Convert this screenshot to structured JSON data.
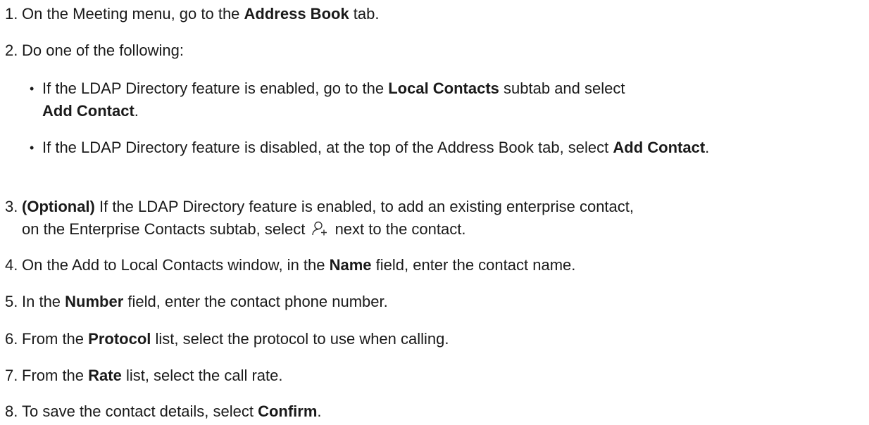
{
  "steps": [
    {
      "n": "1.",
      "a": "On the Meeting menu, go to the ",
      "b": "Address Book",
      "c": " tab."
    },
    {
      "n": "2.",
      "a": "Do one of the following:"
    },
    {
      "n": "3.",
      "b": "(Optional)",
      "c": " If the LDAP Directory feature is enabled, to add an existing enterprise contact,",
      "d": "on the Enterprise Contacts subtab, select ",
      "e": " next to the contact.",
      "icon": "add-contact-icon"
    },
    {
      "n": "4.",
      "a": "On the Add to Local Contacts window, in the ",
      "b": "Name",
      "c": " field, enter the contact name."
    },
    {
      "n": "5.",
      "a": "In the ",
      "b": "Number",
      "c": " field, enter the contact phone number."
    },
    {
      "n": "6.",
      "a": "From the ",
      "b": "Protocol",
      "c": " list, select the protocol to use when calling."
    },
    {
      "n": "7.",
      "a": "From the ",
      "b": "Rate",
      "c": " list, select the call rate."
    },
    {
      "n": "8.",
      "a": "To save the contact details, select ",
      "b": "Confirm",
      "c": "."
    }
  ],
  "bullets": [
    {
      "dot": "•",
      "a": "If the LDAP Directory feature is enabled, go to the ",
      "b": "Local Contacts",
      "c": " subtab and select ",
      "d": "Add Contact",
      "e": "."
    },
    {
      "dot": "•",
      "a": "If the LDAP Directory feature is disabled, at the top of the Address Book tab, select ",
      "b": "Add Contact",
      "c": "."
    }
  ]
}
